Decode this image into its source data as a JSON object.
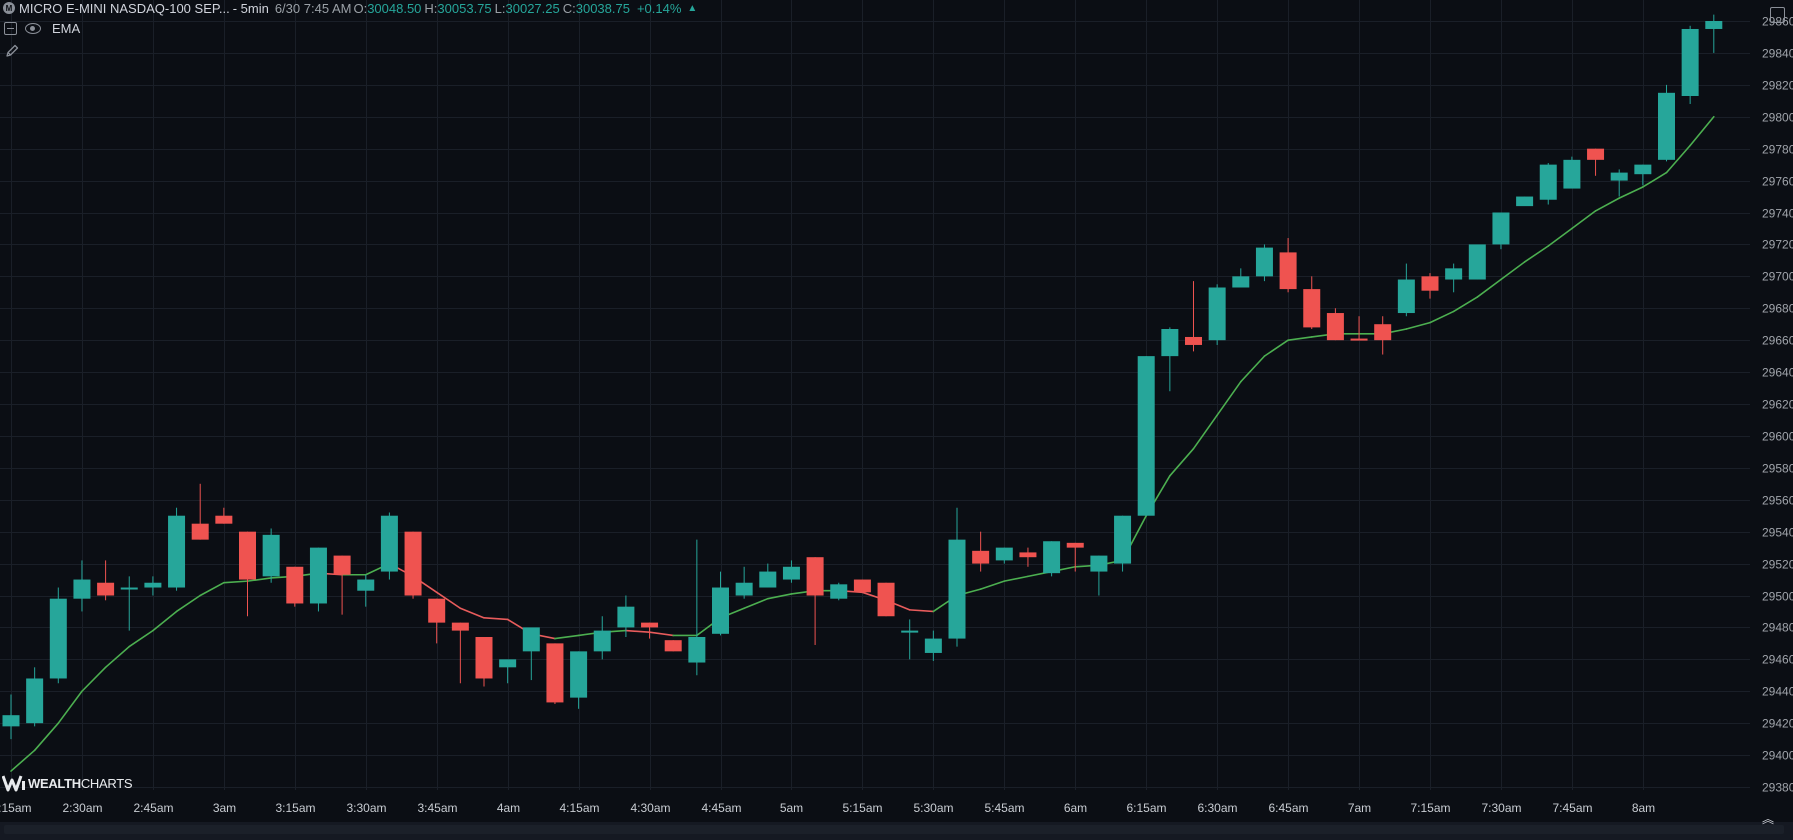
{
  "header": {
    "symbol_badge": "M",
    "symbol": "MICRO E-MINI NASDAQ-100 SEP...",
    "timeframe": "- 5min",
    "datetime": "6/30 7:45 AM",
    "o_label": "O:",
    "o_value": "30048.50",
    "h_label": "H:",
    "h_value": "30053.75",
    "l_label": "L:",
    "l_value": "30027.25",
    "c_label": "C:",
    "c_value": "30038.75",
    "change": "+0.14%"
  },
  "indicator": {
    "name": "EMA"
  },
  "logo": {
    "bold": "WEALTH",
    "thin": "CHARTS"
  },
  "colors": {
    "background": "#0b0e14",
    "grid": "#1a1f28",
    "bull": "#26a69a",
    "bear": "#ef5350",
    "ema_up": "#4caf50",
    "ema_down": "#e85c5c",
    "axis_text": "#a0a4ab"
  },
  "icons": [
    "symbol-badge-icon",
    "collapse-icon",
    "eye-icon",
    "pencil-icon",
    "layout-icon",
    "chevron-up-icon"
  ],
  "chart_data": {
    "type": "candlestick",
    "ylim": [
      29370,
      29870
    ],
    "yticks": [
      29380,
      29400,
      29420,
      29440,
      29460,
      29480,
      29500,
      29520,
      29540,
      29560,
      29580,
      29600,
      29620,
      29640,
      29660,
      29680,
      29700,
      29720,
      29740,
      29760,
      29780,
      29800,
      29820,
      29840,
      29860
    ],
    "xticks": [
      {
        "label": "2:15am",
        "i": 0
      },
      {
        "label": "2:30am",
        "i": 3
      },
      {
        "label": "2:45am",
        "i": 6
      },
      {
        "label": "3am",
        "i": 9
      },
      {
        "label": "3:15am",
        "i": 12
      },
      {
        "label": "3:30am",
        "i": 15
      },
      {
        "label": "3:45am",
        "i": 18
      },
      {
        "label": "4am",
        "i": 21
      },
      {
        "label": "4:15am",
        "i": 24
      },
      {
        "label": "4:30am",
        "i": 27
      },
      {
        "label": "4:45am",
        "i": 30
      },
      {
        "label": "5am",
        "i": 33
      },
      {
        "label": "5:15am",
        "i": 36
      },
      {
        "label": "5:30am",
        "i": 39
      },
      {
        "label": "5:45am",
        "i": 42
      },
      {
        "label": "6am",
        "i": 45
      },
      {
        "label": "6:15am",
        "i": 48
      },
      {
        "label": "6:30am",
        "i": 51
      },
      {
        "label": "6:45am",
        "i": 54
      },
      {
        "label": "7am",
        "i": 57
      },
      {
        "label": "7:15am",
        "i": 60
      },
      {
        "label": "7:30am",
        "i": 63
      },
      {
        "label": "7:45am",
        "i": 66
      },
      {
        "label": "8am",
        "i": 69
      }
    ],
    "candles": [
      [
        29418,
        29438,
        29410,
        29425
      ],
      [
        29420,
        29455,
        29418,
        29448
      ],
      [
        29448,
        29505,
        29445,
        29498
      ],
      [
        29498,
        29522,
        29490,
        29510
      ],
      [
        29508,
        29522,
        29497,
        29500
      ],
      [
        29505,
        29512,
        29478,
        29505
      ],
      [
        29505,
        29512,
        29500,
        29508
      ],
      [
        29505,
        29555,
        29503,
        29550
      ],
      [
        29545,
        29570,
        29535,
        29535
      ],
      [
        29550,
        29555,
        29545,
        29545
      ],
      [
        29540,
        29540,
        29487,
        29510
      ],
      [
        29512,
        29542,
        29508,
        29538
      ],
      [
        29518,
        29518,
        29493,
        29495
      ],
      [
        29495,
        29530,
        29490,
        29530
      ],
      [
        29525,
        29525,
        29488,
        29513
      ],
      [
        29503,
        29513,
        29493,
        29510
      ],
      [
        29515,
        29552,
        29510,
        29550
      ],
      [
        29540,
        29540,
        29498,
        29500
      ],
      [
        29498,
        29498,
        29470,
        29483
      ],
      [
        29483,
        29483,
        29445,
        29478
      ],
      [
        29474,
        29474,
        29443,
        29448
      ],
      [
        29455,
        29458,
        29445,
        29460
      ],
      [
        29465,
        29478,
        29447,
        29480
      ],
      [
        29470,
        29470,
        29432,
        29433
      ],
      [
        29436,
        29465,
        29429,
        29465
      ],
      [
        29465,
        29487,
        29460,
        29478
      ],
      [
        29480,
        29500,
        29474,
        29493
      ],
      [
        29483,
        29483,
        29473,
        29480
      ],
      [
        29472,
        29472,
        29465,
        29465
      ],
      [
        29458,
        29535,
        29450,
        29474
      ],
      [
        29476,
        29515,
        29475,
        29505
      ],
      [
        29500,
        29518,
        29498,
        29508
      ],
      [
        29505,
        29520,
        29505,
        29515
      ],
      [
        29510,
        29522,
        29508,
        29518
      ],
      [
        29524,
        29524,
        29469,
        29500
      ],
      [
        29498,
        29508,
        29497,
        29507
      ],
      [
        29510,
        29510,
        29502,
        29502
      ],
      [
        29508,
        29508,
        29487,
        29487
      ],
      [
        29478,
        29485,
        29460,
        29478
      ],
      [
        29464,
        29478,
        29459,
        29473
      ],
      [
        29473,
        29555,
        29468,
        29535
      ],
      [
        29528,
        29540,
        29515,
        29520
      ],
      [
        29522,
        29530,
        29520,
        29530
      ],
      [
        29527,
        29530,
        29518,
        29524
      ],
      [
        29514,
        29534,
        29512,
        29534
      ],
      [
        29533,
        29533,
        29515,
        29530
      ],
      [
        29515,
        29525,
        29500,
        29525
      ],
      [
        29520,
        29550,
        29515,
        29550
      ],
      [
        29550,
        29650,
        29550,
        29650
      ],
      [
        29650,
        29668,
        29628,
        29667
      ],
      [
        29662,
        29697,
        29653,
        29657
      ],
      [
        29660,
        29695,
        29657,
        29693
      ],
      [
        29693,
        29705,
        29693,
        29700
      ],
      [
        29700,
        29720,
        29697,
        29718
      ],
      [
        29715,
        29724,
        29690,
        29692
      ],
      [
        29692,
        29700,
        29667,
        29668
      ],
      [
        29677,
        29680,
        29660,
        29660
      ],
      [
        29661,
        29675,
        29660,
        29660
      ],
      [
        29670,
        29675,
        29651,
        29660
      ],
      [
        29677,
        29708,
        29675,
        29698
      ],
      [
        29700,
        29702,
        29686,
        29691
      ],
      [
        29698,
        29708,
        29690,
        29705
      ],
      [
        29698,
        29719,
        29698,
        29720
      ],
      [
        29720,
        29740,
        29717,
        29740
      ],
      [
        29744,
        29750,
        29745,
        29750
      ],
      [
        29748,
        29771,
        29745,
        29770
      ],
      [
        29755,
        29775,
        29757,
        29773
      ],
      [
        29780,
        29780,
        29763,
        29773
      ],
      [
        29760,
        29767,
        29750,
        29765
      ],
      [
        29764,
        29770,
        29757,
        29770
      ],
      [
        29773,
        29820,
        29772,
        29815
      ],
      [
        29813,
        29857,
        29808,
        29855
      ],
      [
        29855,
        29864,
        29840,
        29860
      ]
    ],
    "ema": [
      29390,
      29403,
      29420,
      29440,
      29455,
      29468,
      29478,
      29490,
      29500,
      29508,
      29509,
      29511,
      29512,
      29514,
      29513,
      29513,
      29520,
      29512,
      29502,
      29492,
      29486,
      29485,
      29476,
      29473,
      29475,
      29477,
      29478,
      29477,
      29475,
      29475,
      29486,
      29492,
      29498,
      29501,
      29503,
      29503,
      29502,
      29497,
      29491,
      29490,
      29500,
      29504,
      29509,
      29512,
      29515,
      29518,
      29519,
      29522,
      29550,
      29575,
      29592,
      29613,
      29634,
      29650,
      29660,
      29662,
      29664,
      29664,
      29664,
      29667,
      29671,
      29678,
      29687,
      29698,
      29709,
      29719,
      29730,
      29741,
      29749,
      29756,
      29765,
      29782,
      29800
    ]
  }
}
